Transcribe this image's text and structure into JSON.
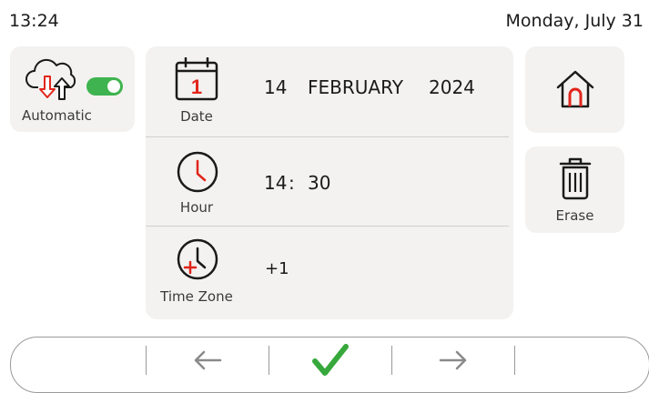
{
  "status_bar": {
    "time": "13:24",
    "date": "Monday, July 31"
  },
  "automatic": {
    "label": "Automatic",
    "toggle_on": true,
    "icon": "cloud-sync-icon"
  },
  "date_row": {
    "label": "Date",
    "icon": "calendar-icon",
    "calendar_day": "1",
    "day": "14",
    "month": "FEBRUARY",
    "year": "2024"
  },
  "hour_row": {
    "label": "Hour",
    "icon": "clock-icon",
    "hours": "14",
    "separator": ":",
    "minutes": "30"
  },
  "timezone_row": {
    "label": "Time Zone",
    "icon": "timezone-clock-icon",
    "offset": "+1"
  },
  "home": {
    "icon": "home-icon"
  },
  "erase": {
    "label": "Erase",
    "icon": "trash-icon"
  },
  "nav": {
    "back_icon": "arrow-left-icon",
    "confirm_icon": "checkmark-icon",
    "forward_icon": "arrow-right-icon"
  },
  "colors": {
    "accent_red": "#e1251b",
    "toggle_green": "#3fb34f",
    "confirm_green": "#36a83c",
    "card_bg": "#f3f2f0"
  }
}
